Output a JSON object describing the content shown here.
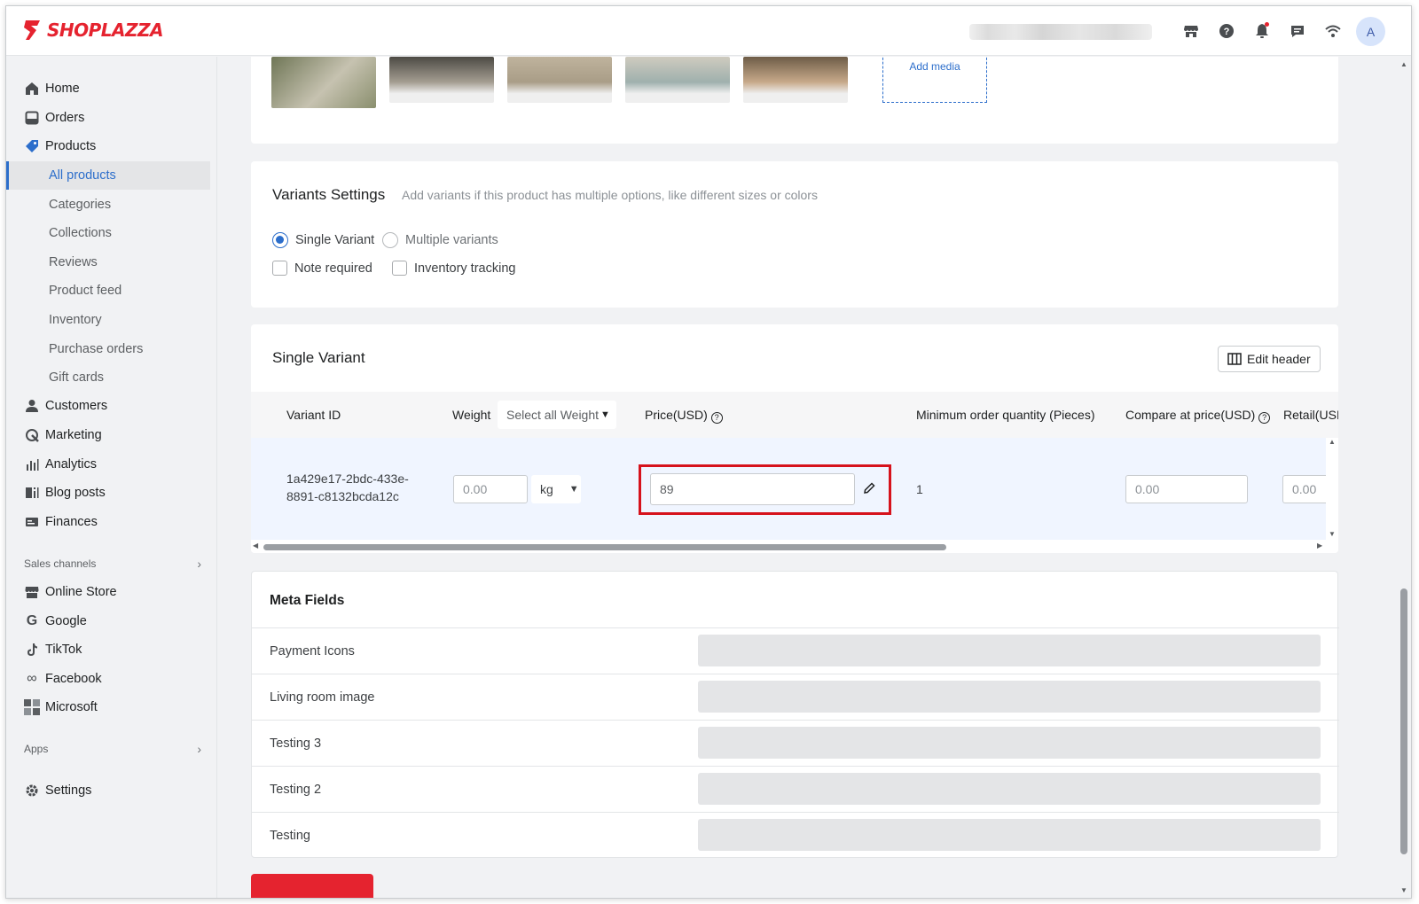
{
  "brand": {
    "name": "SHOPLAZZA",
    "color": "#e5232f"
  },
  "topbar": {
    "icons": [
      "store-icon",
      "help-icon",
      "bell-icon",
      "chat-icon",
      "wifi-icon"
    ],
    "avatar_letter": "A"
  },
  "sidebar": {
    "main_items": [
      {
        "label": "Home",
        "icon": "home-icon"
      },
      {
        "label": "Orders",
        "icon": "orders-icon"
      },
      {
        "label": "Products",
        "icon": "tag-icon"
      }
    ],
    "product_sub_items": [
      "All products",
      "Categories",
      "Collections",
      "Reviews",
      "Product feed",
      "Inventory",
      "Purchase orders",
      "Gift cards"
    ],
    "active_sub_item": "All products",
    "more_items": [
      {
        "label": "Customers",
        "icon": "person-icon"
      },
      {
        "label": "Marketing",
        "icon": "marketing-icon"
      },
      {
        "label": "Analytics",
        "icon": "analytics-icon"
      },
      {
        "label": "Blog posts",
        "icon": "blog-icon"
      },
      {
        "label": "Finances",
        "icon": "finance-icon"
      }
    ],
    "sales_channels_label": "Sales channels",
    "channels": [
      {
        "label": "Online Store",
        "icon": "store-icon"
      },
      {
        "label": "Google",
        "icon": "google-icon"
      },
      {
        "label": "TikTok",
        "icon": "tiktok-icon"
      },
      {
        "label": "Facebook",
        "icon": "meta-icon"
      },
      {
        "label": "Microsoft",
        "icon": "microsoft-icon"
      }
    ],
    "apps_label": "Apps",
    "settings_label": "Settings"
  },
  "media": {
    "add_media_label": "Add media",
    "thumb_colors": [
      "#8a8f6e",
      "#7d776b",
      "#a99d87",
      "#b7b6ac",
      "#a38d72"
    ]
  },
  "variants_settings": {
    "title": "Variants Settings",
    "hint": "Add variants if this product has multiple options, like different sizes or colors",
    "single_variant_label": "Single Variant",
    "multiple_variants_label": "Multiple variants",
    "selected": "Single Variant",
    "note_required_label": "Note required",
    "inventory_tracking_label": "Inventory tracking"
  },
  "single_variant": {
    "title": "Single Variant",
    "edit_header_label": "Edit header",
    "columns": {
      "variant_id": "Variant ID",
      "weight": "Weight",
      "weight_select": "Select all Weight",
      "price": "Price(USD)",
      "min_qty": "Minimum order quantity (Pieces)",
      "compare_price": "Compare at price(USD)",
      "retail": "Retail(USI"
    },
    "row": {
      "variant_id_line1": "1a429e17-2bdc-433e-",
      "variant_id_line2": "8891-c8132bcda12c",
      "weight_placeholder": "0.00",
      "weight_unit": "kg",
      "price_value": "89",
      "min_qty": "1",
      "compare_price_placeholder": "0.00",
      "retail_placeholder": "0.00"
    },
    "highlight_color": "#d6121c"
  },
  "meta_fields": {
    "title": "Meta Fields",
    "rows": [
      "Payment Icons",
      "Living room image",
      "Testing 3",
      "Testing 2",
      "Testing"
    ]
  }
}
